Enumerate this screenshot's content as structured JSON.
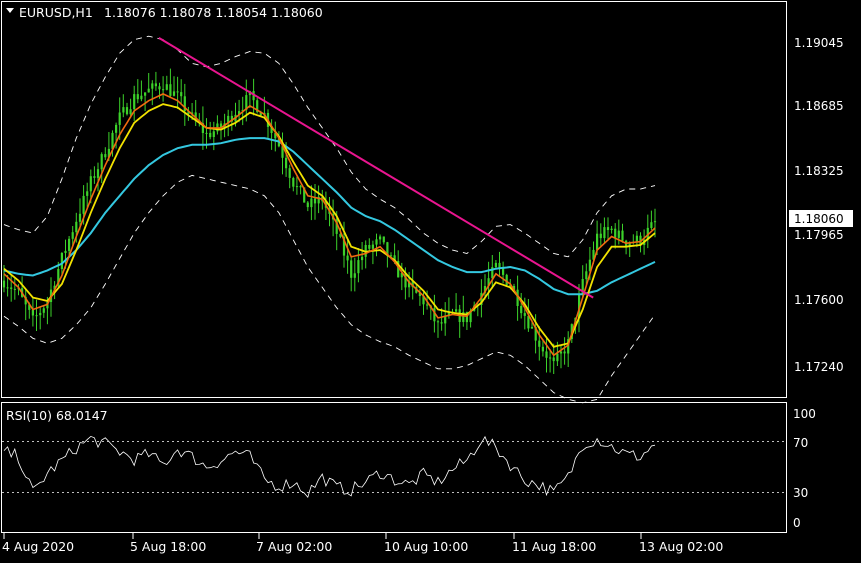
{
  "header": {
    "symbol_tf": "EURUSD,H1",
    "ohlc": "1.18076 1.18078 1.18054 1.18060"
  },
  "price_axis": {
    "ticks": [
      "1.19045",
      "1.18685",
      "1.18325",
      "1.17965",
      "1.17600",
      "1.17240"
    ],
    "current_price": "1.18060"
  },
  "rsi": {
    "label": "RSI(10) 68.0147",
    "ticks": [
      "100",
      "70",
      "30",
      "0"
    ]
  },
  "time_axis": {
    "labels": [
      "4 Aug 2020",
      "5 Aug 18:00",
      "7 Aug 02:00",
      "10 Aug 10:00",
      "11 Aug 18:00",
      "13 Aug 02:00"
    ]
  },
  "colors": {
    "background": "#000000",
    "candles": "#3cd22a",
    "ma_fast": "#f06a10",
    "ma_mid": "#f2e200",
    "ma_slow": "#34c8e0",
    "bands": "#ffffff",
    "trendline": "#e8158f",
    "text": "#ffffff"
  },
  "chart_data": [
    {
      "type": "line",
      "title": "EURUSD,H1",
      "ylim": [
        1.1704,
        1.1935
      ],
      "y_ticks": [
        1.19045,
        1.18685,
        1.18325,
        1.17965,
        1.176,
        1.1724
      ],
      "x_labels": [
        "4 Aug 2020",
        "5 Aug 18:00",
        "7 Aug 02:00",
        "10 Aug 10:00",
        "11 Aug 18:00",
        "13 Aug 02:00"
      ],
      "current_price": 1.1806,
      "price_path": [
        1.1772,
        1.1765,
        1.1748,
        1.176,
        1.1785,
        1.1808,
        1.183,
        1.1848,
        1.1868,
        1.188,
        1.1884,
        1.1888,
        1.188,
        1.1868,
        1.1858,
        1.1862,
        1.1872,
        1.188,
        1.187,
        1.1852,
        1.183,
        1.1816,
        1.182,
        1.18,
        1.1776,
        1.179,
        1.1795,
        1.178,
        1.1768,
        1.176,
        1.1745,
        1.1752,
        1.175,
        1.1765,
        1.178,
        1.177,
        1.1752,
        1.1735,
        1.1722,
        1.1735,
        1.177,
        1.1798,
        1.1802,
        1.1795,
        1.1796,
        1.1806
      ],
      "ma_fast": [
        1.1776,
        1.1768,
        1.1755,
        1.1758,
        1.1775,
        1.1798,
        1.182,
        1.184,
        1.1858,
        1.1872,
        1.1878,
        1.1882,
        1.1878,
        1.187,
        1.1862,
        1.1862,
        1.1868,
        1.1875,
        1.187,
        1.1856,
        1.1838,
        1.1822,
        1.182,
        1.1806,
        1.1786,
        1.1788,
        1.1792,
        1.1783,
        1.1771,
        1.1763,
        1.175,
        1.1752,
        1.1751,
        1.1762,
        1.1776,
        1.177,
        1.1756,
        1.174,
        1.1728,
        1.1734,
        1.1762,
        1.179,
        1.1798,
        1.1794,
        1.1795,
        1.1803
      ],
      "ma_mid": [
        1.1779,
        1.1772,
        1.1762,
        1.176,
        1.177,
        1.179,
        1.1812,
        1.1832,
        1.185,
        1.1865,
        1.1872,
        1.1876,
        1.1874,
        1.1868,
        1.1862,
        1.1861,
        1.1865,
        1.1871,
        1.1868,
        1.1857,
        1.1842,
        1.1828,
        1.1822,
        1.181,
        1.1792,
        1.1789,
        1.179,
        1.1784,
        1.1774,
        1.1766,
        1.1755,
        1.1753,
        1.1752,
        1.1759,
        1.1771,
        1.1768,
        1.1758,
        1.1744,
        1.1733,
        1.1735,
        1.1755,
        1.178,
        1.1792,
        1.1792,
        1.1793,
        1.18
      ],
      "ma_slow": [
        1.1778,
        1.1776,
        1.1775,
        1.1778,
        1.1782,
        1.179,
        1.18,
        1.1812,
        1.1822,
        1.1832,
        1.184,
        1.1846,
        1.185,
        1.1852,
        1.1852,
        1.1853,
        1.1855,
        1.1856,
        1.1856,
        1.1854,
        1.1848,
        1.184,
        1.1832,
        1.1824,
        1.1815,
        1.181,
        1.1807,
        1.1802,
        1.1796,
        1.179,
        1.1784,
        1.178,
        1.1777,
        1.1777,
        1.1779,
        1.178,
        1.1778,
        1.1773,
        1.1767,
        1.1764,
        1.1764,
        1.1766,
        1.1771,
        1.1775,
        1.1779,
        1.1783
      ],
      "band_upper": [
        1.1805,
        1.1802,
        1.18,
        1.181,
        1.1832,
        1.1856,
        1.1876,
        1.1892,
        1.1906,
        1.1914,
        1.1916,
        1.1914,
        1.1908,
        1.19,
        1.1898,
        1.19,
        1.1904,
        1.1907,
        1.1906,
        1.19,
        1.1888,
        1.1874,
        1.1862,
        1.185,
        1.1836,
        1.1826,
        1.182,
        1.1815,
        1.1808,
        1.18,
        1.1794,
        1.179,
        1.1788,
        1.1795,
        1.1804,
        1.1805,
        1.18,
        1.1794,
        1.1788,
        1.1786,
        1.1796,
        1.1812,
        1.1822,
        1.1826,
        1.1826,
        1.1828
      ],
      "band_lower": [
        1.1751,
        1.1745,
        1.1738,
        1.1735,
        1.1738,
        1.1746,
        1.1756,
        1.177,
        1.1785,
        1.18,
        1.1812,
        1.1822,
        1.183,
        1.1834,
        1.1832,
        1.183,
        1.1828,
        1.1826,
        1.1822,
        1.1812,
        1.1796,
        1.178,
        1.1768,
        1.1756,
        1.1746,
        1.174,
        1.1736,
        1.1733,
        1.1728,
        1.1724,
        1.172,
        1.172,
        1.1722,
        1.1726,
        1.173,
        1.1728,
        1.1722,
        1.1714,
        1.1706,
        1.1702,
        1.17,
        1.1702,
        1.1716,
        1.1728,
        1.174,
        1.1752
      ],
      "trendline": [
        [
          0.238,
          1.1915
        ],
        [
          0.905,
          1.1762
        ]
      ]
    },
    {
      "type": "line",
      "title": "RSI(10) 68.0147",
      "ylim": [
        0,
        100
      ],
      "levels": [
        70,
        30
      ],
      "values": [
        62,
        58,
        30,
        45,
        55,
        65,
        72,
        68,
        62,
        56,
        60,
        52,
        64,
        58,
        50,
        55,
        62,
        58,
        40,
        35,
        38,
        30,
        42,
        34,
        32,
        38,
        46,
        40,
        36,
        44,
        38,
        48,
        55,
        72,
        65,
        52,
        40,
        36,
        30,
        42,
        68,
        72,
        66,
        60,
        58,
        68
      ]
    }
  ]
}
